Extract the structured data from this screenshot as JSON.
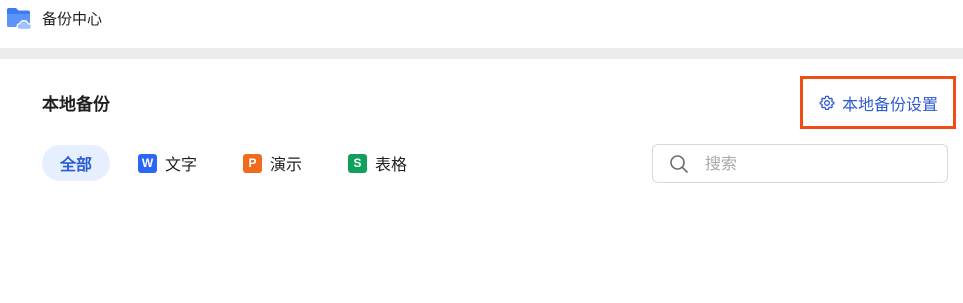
{
  "window": {
    "title": "备份中心",
    "icon": "folder-cloud-icon"
  },
  "section": {
    "title": "本地备份"
  },
  "settings": {
    "label": "本地备份设置",
    "icon": "gear-icon",
    "color": "#2f5bd3",
    "highlight_color": "#ef4d16"
  },
  "filters": [
    {
      "label": "全部",
      "active": true
    },
    {
      "label": "文字",
      "badge": "W",
      "badge_color": "#2b67f6",
      "icon": "word-doc-icon"
    },
    {
      "label": "演示",
      "badge": "P",
      "badge_color": "#f26a1b",
      "icon": "presentation-icon"
    },
    {
      "label": "表格",
      "badge": "S",
      "badge_color": "#11a05b",
      "icon": "spreadsheet-icon"
    }
  ],
  "search": {
    "placeholder": "搜索",
    "value": "",
    "icon": "search-icon"
  }
}
